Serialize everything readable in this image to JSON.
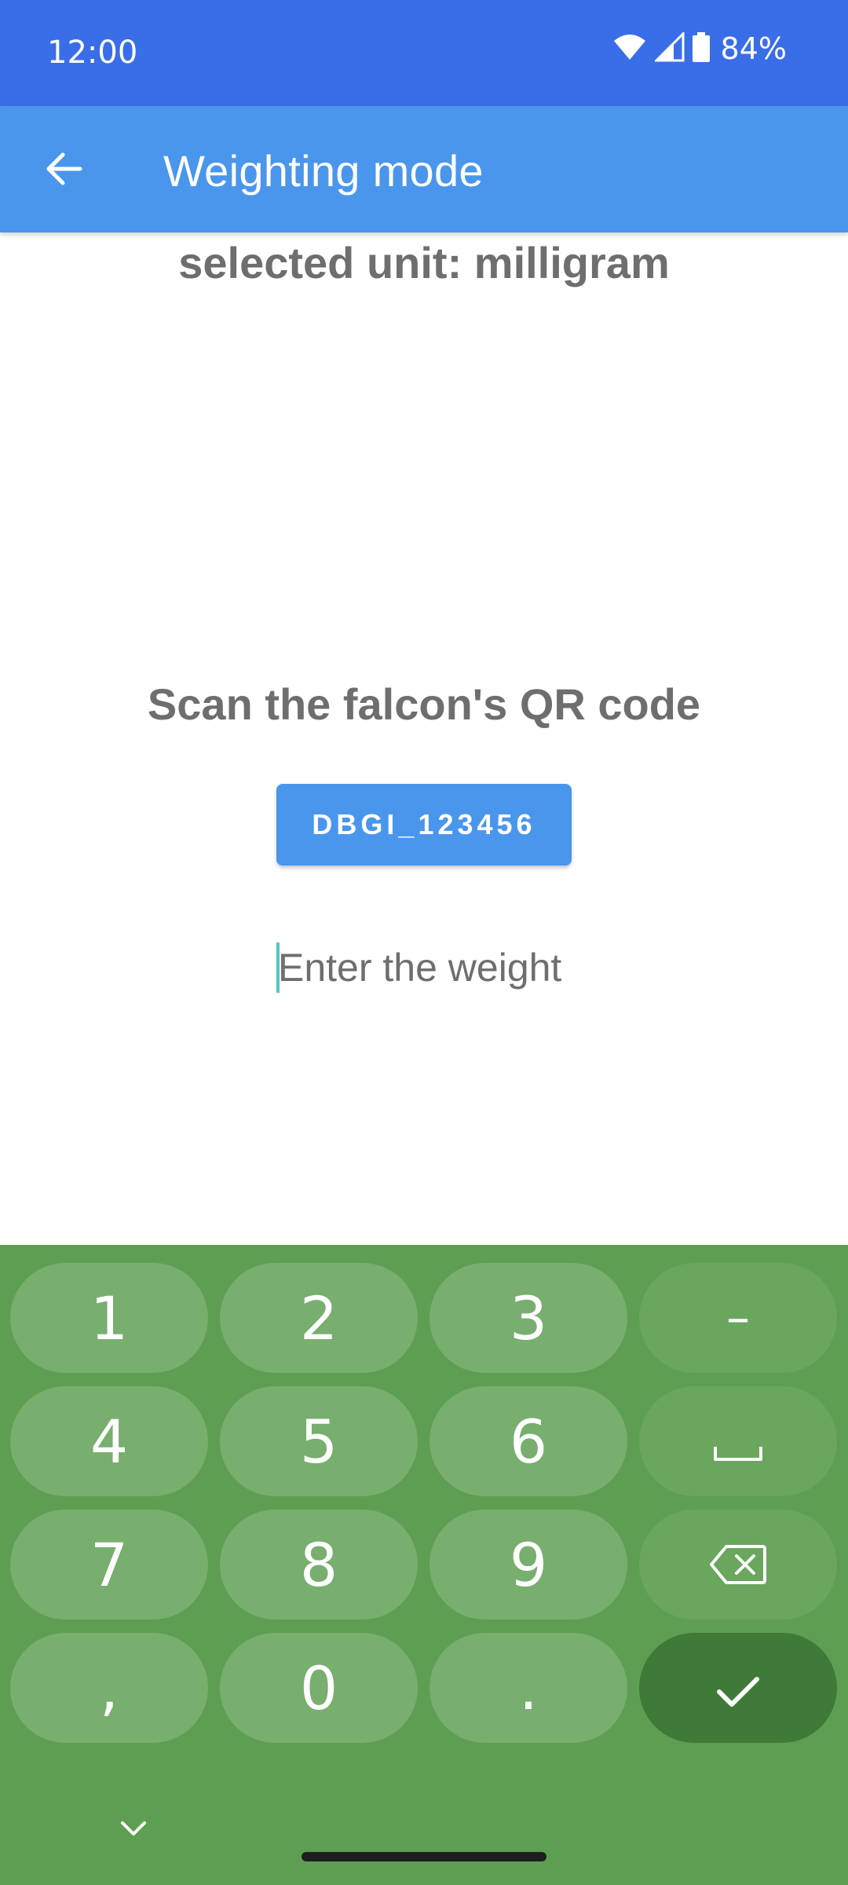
{
  "status_bar": {
    "time": "12:00",
    "battery_percent": "84%",
    "icons": [
      "wifi-icon",
      "cell-signal-icon",
      "battery-icon"
    ]
  },
  "app_bar": {
    "title": "Weighting mode",
    "back_icon": "arrow-back-icon"
  },
  "main": {
    "unit_label": "selected unit: milligram",
    "scan_label": "Scan the falcon's QR code",
    "id_button_label": "DBGI_123456",
    "weight_placeholder": "Enter the weight",
    "weight_value": ""
  },
  "keyboard": {
    "keys": {
      "k1": "1",
      "k2": "2",
      "k3": "3",
      "minus": "–",
      "k4": "4",
      "k5": "5",
      "k6": "6",
      "k7": "7",
      "k8": "8",
      "k9": "9",
      "comma": ",",
      "k0": "0",
      "period": "."
    },
    "fn_icons": [
      "space-icon",
      "backspace-icon",
      "check-icon",
      "chevron-down-icon"
    ]
  },
  "colors": {
    "status_bar": "#3a6ee8",
    "app_bar": "#4a96ec",
    "keyboard_bg": "#5e9e52",
    "key_bg": "#78ae6e",
    "key_fn_bg": "#6aa65e",
    "key_enter_bg": "#3f7a38",
    "text_gray": "#6e6e6e"
  }
}
